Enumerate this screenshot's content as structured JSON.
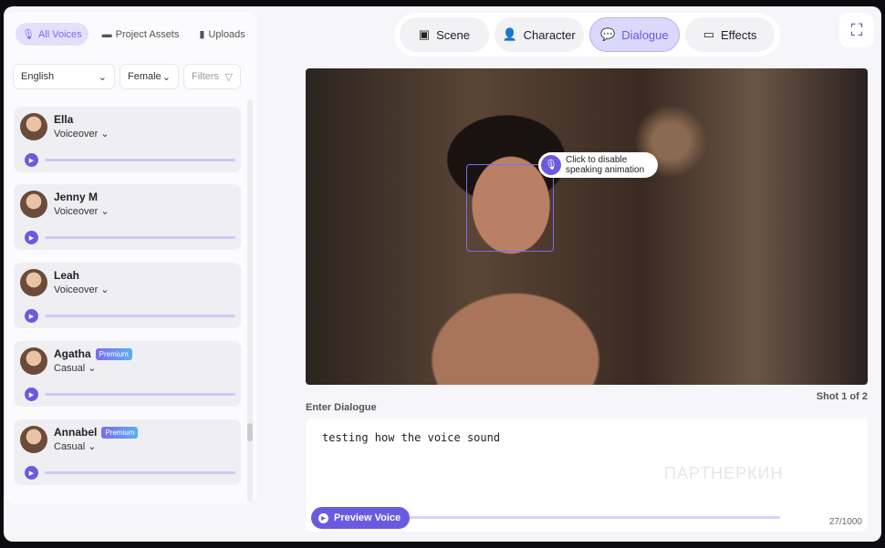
{
  "voice_tabs": [
    {
      "label": "All Voices",
      "icon": "mic-icon"
    },
    {
      "label": "Project Assets",
      "icon": "folder-icon"
    },
    {
      "label": "Uploads",
      "icon": "file-icon"
    }
  ],
  "filters": {
    "language": "English",
    "gender": "Female",
    "filters_label": "Filters"
  },
  "voices": [
    {
      "name": "Ella",
      "type": "Voiceover",
      "badge": null
    },
    {
      "name": "Jenny M",
      "type": "Voiceover",
      "badge": null
    },
    {
      "name": "Leah",
      "type": "Voiceover",
      "badge": null
    },
    {
      "name": "Agatha",
      "type": "Casual",
      "badge": "Premium"
    },
    {
      "name": "Annabel",
      "type": "Casual",
      "badge": "Premium"
    }
  ],
  "tabs": [
    {
      "label": "Scene"
    },
    {
      "label": "Character"
    },
    {
      "label": "Dialogue",
      "active": true
    },
    {
      "label": "Effects"
    }
  ],
  "tooltip": {
    "line1": "Click to disable",
    "line2": "speaking animation"
  },
  "shot": "Shot 1 of 2",
  "dialogue": {
    "label": "Enter Dialogue",
    "value": "testing how the voice sound",
    "count": "27/1000",
    "preview_label": "Preview Voice"
  },
  "watermark": "ПАРТНЕРКИН",
  "colors": {
    "accent": "#6a5ae0",
    "accent_light": "#dcd8fb"
  }
}
